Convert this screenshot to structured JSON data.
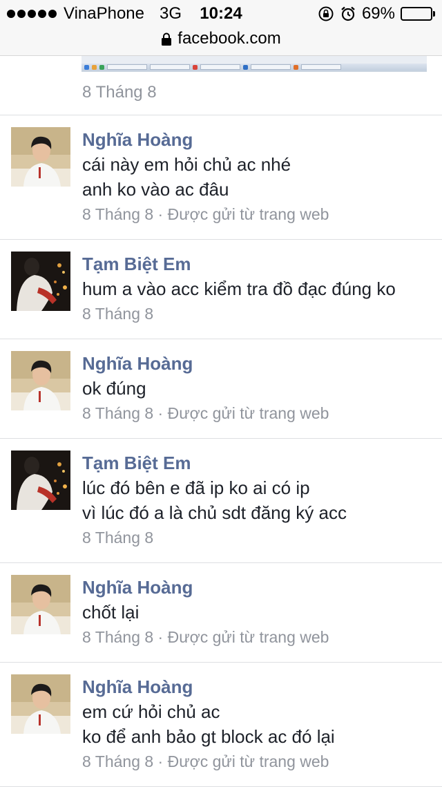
{
  "status_bar": {
    "carrier": "VinaPhone",
    "network": "3G",
    "time": "10:24",
    "battery": "69%",
    "battery_level": 0.69,
    "icons": [
      "orientation-lock-icon",
      "alarm-icon",
      "battery-icon"
    ]
  },
  "url_bar": {
    "domain": "facebook.com",
    "icon": "lock-icon"
  },
  "first_block": {
    "meta": "8 Tháng 8"
  },
  "comments": [
    {
      "author": "Nghĩa Hoàng",
      "lines": [
        "cái này em hỏi chủ ac nhé",
        "anh ko vào ac đâu"
      ],
      "meta": "8 Tháng 8 · Được gửi từ trang web"
    },
    {
      "author": "Tạm Biệt Em",
      "lines": [
        "hum a vào acc kiểm tra đồ đạc đúng ko"
      ],
      "meta": "8 Tháng 8"
    },
    {
      "author": "Nghĩa Hoàng",
      "lines": [
        "ok đúng"
      ],
      "meta": "8 Tháng 8 · Được gửi từ trang web"
    },
    {
      "author": "Tạm Biệt Em",
      "lines": [
        "lúc đó bên e đã ip ko ai có ip",
        "vì lúc đó a là chủ sdt đăng ký acc"
      ],
      "meta": "8 Tháng 8"
    },
    {
      "author": "Nghĩa Hoàng",
      "lines": [
        "chốt lại"
      ],
      "meta": "8 Tháng 8 · Được gửi từ trang web"
    },
    {
      "author": "Nghĩa Hoàng",
      "lines": [
        "em cứ hỏi chủ ac",
        "ko để anh bảo gt block ac đó lại"
      ],
      "meta": "8 Tháng 8 · Được gửi từ trang web"
    }
  ],
  "colors": {
    "author": "#576b95",
    "text": "#1d2129",
    "meta": "#90949c",
    "divider": "#dddfe2"
  }
}
